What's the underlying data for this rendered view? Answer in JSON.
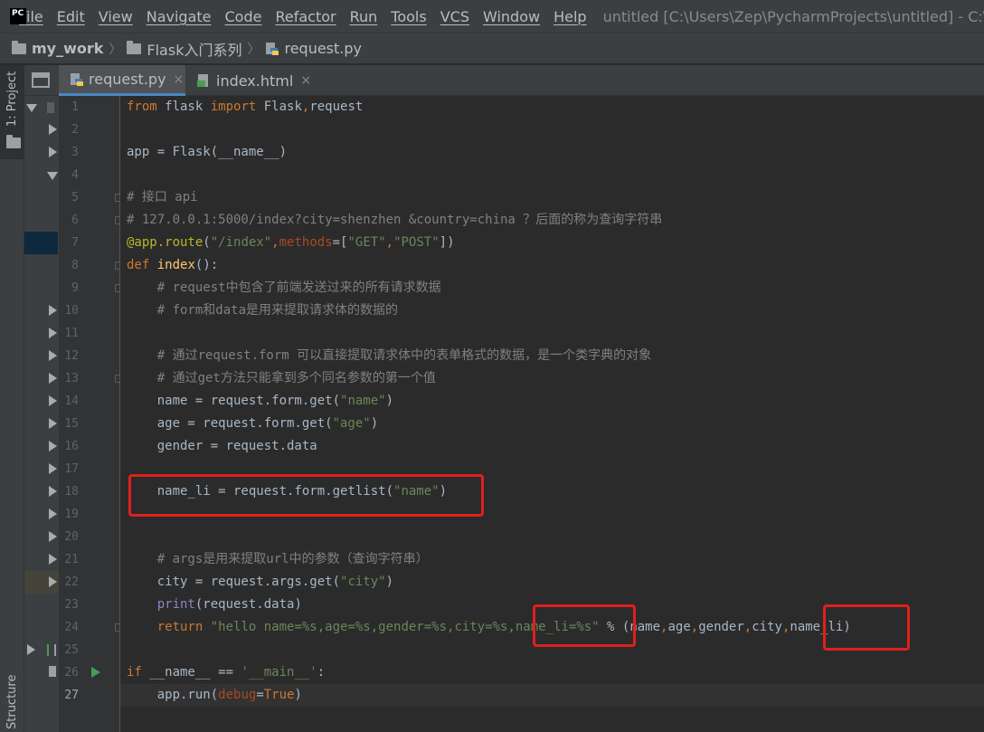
{
  "menubar": {
    "logo_text": "PC",
    "items": [
      "File",
      "Edit",
      "View",
      "Navigate",
      "Code",
      "Refactor",
      "Run",
      "Tools",
      "VCS",
      "Window",
      "Help"
    ],
    "window_title": "untitled [C:\\Users\\Zep\\PycharmProjects\\untitled] - C:\\User"
  },
  "breadcrumb": {
    "project": "my_work",
    "folder": "Flask入门系列",
    "file": "request.py",
    "separator": "〉"
  },
  "side_panel": {
    "project_tab": "1: Project",
    "structure_tab": "Structure"
  },
  "tabs": [
    {
      "label": "request.py",
      "active": true,
      "close": "×"
    },
    {
      "label": "index.html",
      "active": false,
      "close": "×"
    }
  ],
  "editor": {
    "current_line": 27,
    "line_numbers": [
      "1",
      "2",
      "3",
      "4",
      "5",
      "6",
      "7",
      "8",
      "9",
      "10",
      "11",
      "12",
      "13",
      "14",
      "15",
      "16",
      "17",
      "18",
      "19",
      "20",
      "21",
      "22",
      "23",
      "24",
      "25",
      "26",
      "27"
    ],
    "lines": [
      "from flask import Flask,request",
      "",
      "app = Flask(__name__)",
      "",
      "# 接口 api",
      "# 127.0.0.1:5000/index?city=shenzhen &country=china ？后面的称为查询字符串",
      "@app.route(\"/index\",methods=[\"GET\",\"POST\"])",
      "def index():",
      "    # request中包含了前端发送过来的所有请求数据",
      "    # form和data是用来提取请求体的数据的",
      "",
      "    # 通过request.form 可以直接提取请求体中的表单格式的数据，是一个类字典的对象",
      "    # 通过get方法只能拿到多个同名参数的第一个值",
      "    name = request.form.get(\"name\")",
      "    age = request.form.get(\"age\")",
      "    gender = request.data",
      "",
      "    name_li = request.form.getlist(\"name\")",
      "",
      "",
      "    # args是用来提取url中的参数（查询字符串）",
      "    city = request.args.get(\"city\")",
      "    print(request.data)",
      "    return \"hello name=%s,age=%s,gender=%s,city=%s,name_li=%s\" % (name,age,gender,city,name_li)",
      "",
      "if __name__ == '__main__':",
      "    app.run(debug=True)"
    ]
  },
  "colors": {
    "keyword": "#cc7832",
    "string": "#6a8759",
    "comment": "#808080",
    "decorator": "#bbb529",
    "highlight_box": "#e0201c"
  }
}
